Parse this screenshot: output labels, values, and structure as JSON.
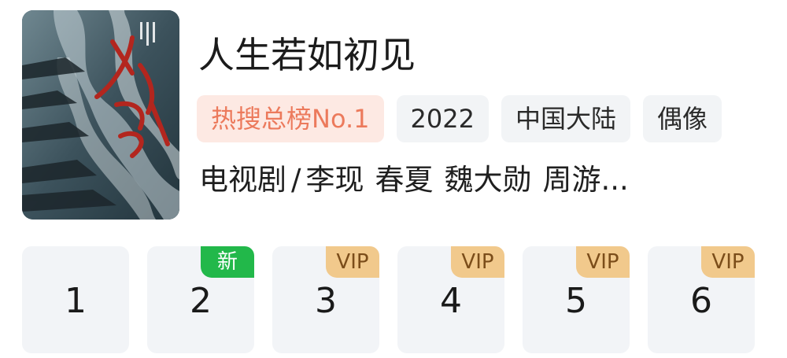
{
  "show": {
    "title": "人生若如初见",
    "tags": [
      {
        "label": "热搜总榜No.1",
        "kind": "hot"
      },
      {
        "label": "2022",
        "kind": "normal"
      },
      {
        "label": "中国大陆",
        "kind": "normal"
      },
      {
        "label": "偶像",
        "kind": "normal"
      }
    ],
    "meta": {
      "type": "电视剧",
      "separator": "/",
      "actors": [
        "李现",
        "春夏",
        "魏大勋",
        "周游..."
      ]
    },
    "poster": {
      "calligraphy_title": "人生若如初见"
    }
  },
  "episodes": [
    {
      "number": "1",
      "badge": ""
    },
    {
      "number": "2",
      "badge": "新"
    },
    {
      "number": "3",
      "badge": "VIP"
    },
    {
      "number": "4",
      "badge": "VIP"
    },
    {
      "number": "5",
      "badge": "VIP"
    },
    {
      "number": "6",
      "badge": "VIP"
    }
  ],
  "colors": {
    "hot_tag_bg": "#fde9e3",
    "hot_tag_text": "#ec7a5c",
    "vip_badge": "#f1c98c",
    "new_badge": "#22b84a",
    "episode_bg": "#f2f4f7"
  }
}
